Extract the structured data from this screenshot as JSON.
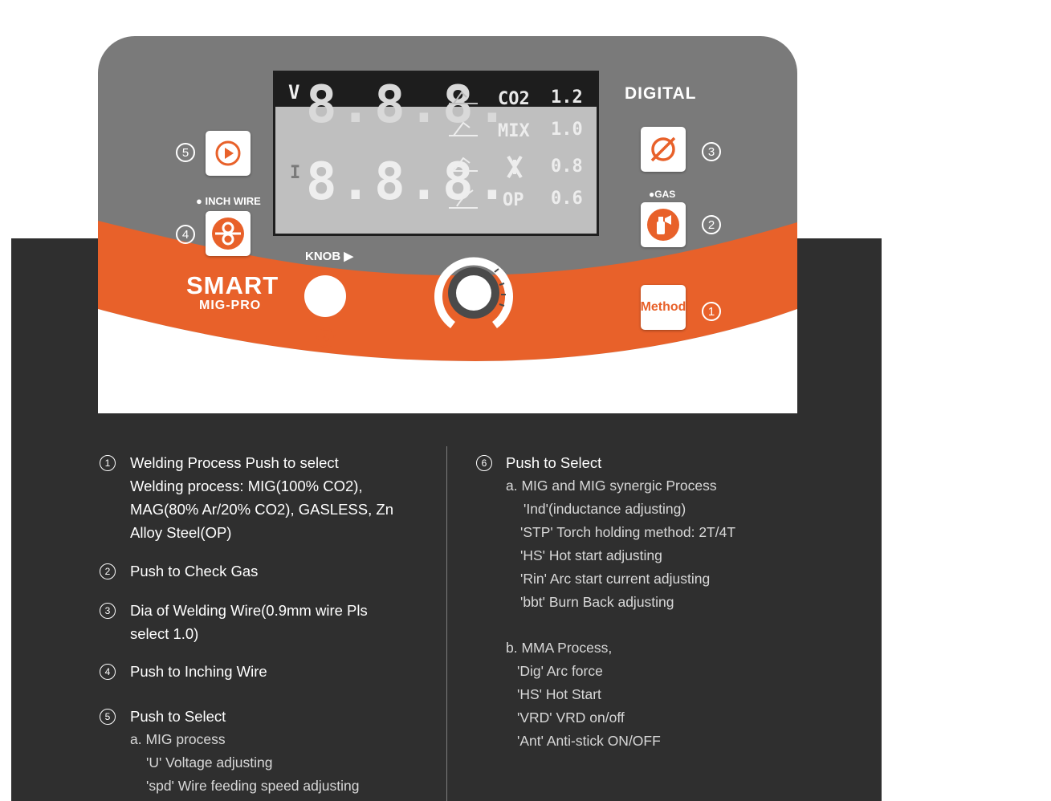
{
  "panel": {
    "brand_top": "DIGITAL",
    "brand_main": "SMART",
    "brand_sub": "MIG-PRO",
    "knob_label": "KNOB",
    "inch_wire_label": "INCH WIRE",
    "gas_label": "GAS",
    "method_label": "Method",
    "numbers": {
      "n1": "1",
      "n2": "2",
      "n3": "3",
      "n4": "4",
      "n5": "5",
      "n6": "6"
    },
    "colors": {
      "orange": "#e8612a",
      "gray": "#7a7a7a",
      "dark": "#2f2f2f",
      "white": "#ffffff"
    }
  },
  "lcd": {
    "v_label": "V",
    "i_label": "I",
    "digits_top": "8.8.8.",
    "digits_bottom": "8.8.8.",
    "gas_rows": [
      {
        "gas": "CO2",
        "wire": "1.2"
      },
      {
        "gas": "MIX",
        "wire": "1.0"
      },
      {
        "gas": "",
        "wire": "0.8"
      },
      {
        "gas": "OP",
        "wire": "0.6"
      }
    ]
  },
  "descriptions": {
    "left": [
      {
        "num": "1",
        "lines": [
          "Welding Process Push to select",
          "Welding process: MIG(100% CO2),",
          "MAG(80% Ar/20% CO2), GASLESS, Zn",
          "Alloy Steel(OP)"
        ]
      },
      {
        "num": "2",
        "lines": [
          "Push to Check Gas"
        ]
      },
      {
        "num": "3",
        "lines": [
          "Dia of Welding Wire(0.9mm wire Pls",
          "select 1.0)"
        ]
      },
      {
        "num": "4",
        "lines": [
          "Push to Inching Wire"
        ]
      },
      {
        "num": "5",
        "lines": [
          "Push to Select"
        ],
        "sub": [
          "a. MIG process",
          "'U' Voltage adjusting",
          "'spd' Wire feeding speed adjusting"
        ]
      }
    ],
    "right": {
      "num": "6",
      "title": "Push to Select",
      "group_a": [
        "a. MIG and MIG synergic Process",
        "'Ind'(inductance adjusting)",
        "'STP' Torch holding method: 2T/4T",
        "'HS' Hot start adjusting",
        "'Rin' Arc start current adjusting",
        "'bbt' Burn Back adjusting"
      ],
      "group_b": [
        "b. MMA Process,",
        "'Dig' Arc force",
        "'HS' Hot Start",
        "'VRD' VRD on/off",
        "'Ant' Anti-stick ON/OFF"
      ]
    }
  }
}
